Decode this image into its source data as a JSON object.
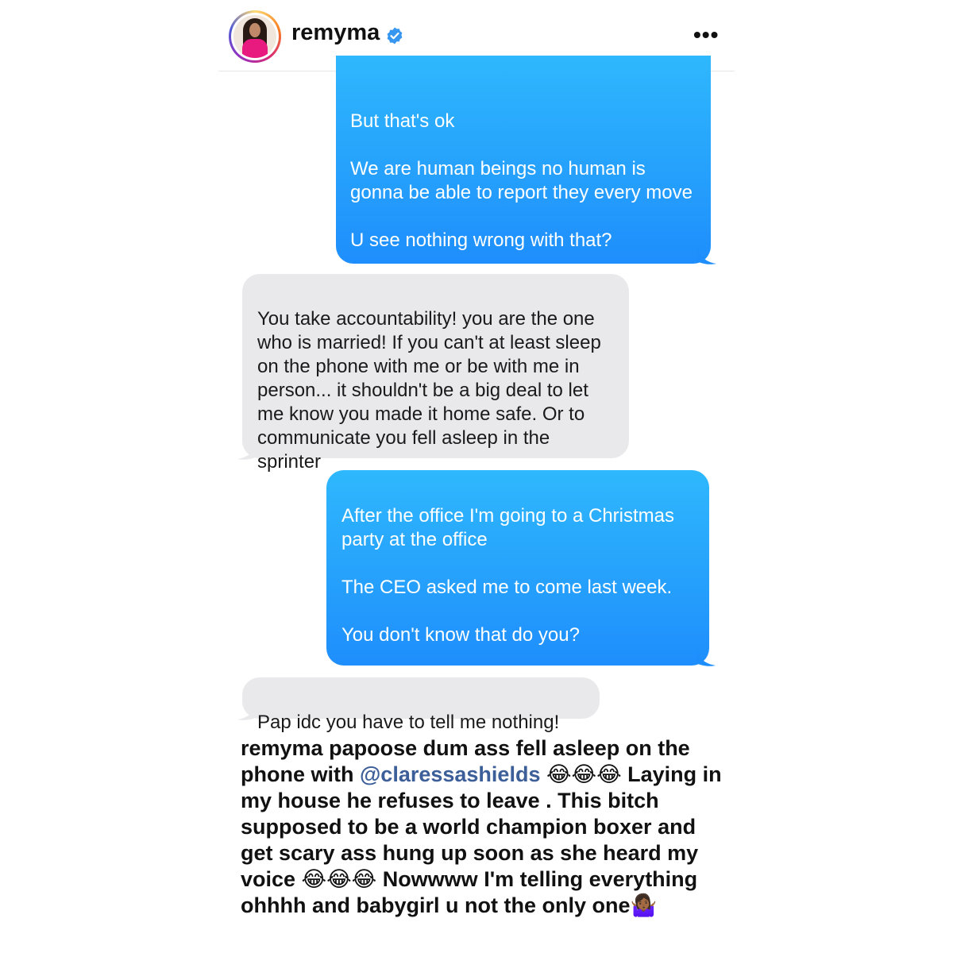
{
  "header": {
    "username": "remyma",
    "verified_icon": "verified-badge-icon",
    "more_icon": "more-options-icon",
    "more_label": "•••"
  },
  "messages": [
    {
      "from": "sent",
      "text": "But that's ok\n\nWe are human beings no human is gonna be able to report they every move\n\nU see nothing wrong with that?"
    },
    {
      "from": "received",
      "text": "You take accountability! you are the one who is married! If you can't at least sleep on the phone with me or be with me in person... it shouldn't be a big deal to let me know you made it home safe. Or to communicate you fell asleep in the sprinter"
    },
    {
      "from": "sent",
      "text": "After the office I'm going to a Christmas party at the office\n\nThe CEO asked me to come last week.\n\nYou don't know that do you?"
    },
    {
      "from": "received",
      "text": "Pap idc you have to tell me nothing!"
    }
  ],
  "caption": {
    "author": "remyma",
    "text_before_mention": " papoose  dum ass fell asleep on the phone with ",
    "mention": "@claressashields",
    "text_after_mention": " 😂😂😂 Laying in my house he refuses to leave . This bitch supposed to be a world champion boxer and get scary ass hung up soon as she heard my voice 😂😂😂 Nowwww I'm telling everything ohhhh and babygirl u not the only one🤷🏾‍♀️"
  },
  "colors": {
    "sent_bubble": "#1e8efc",
    "received_bubble": "#e9e9eb",
    "mention": "#3c5f99",
    "verified": "#3797f0"
  }
}
